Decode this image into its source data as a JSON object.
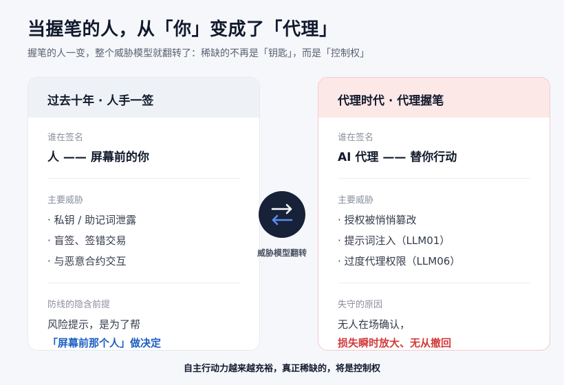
{
  "title": "当握笔的人，从「你」变成了「代理」",
  "subtitle": "握笔的人一变，整个威胁模型就翻转了：稀缺的不再是「钥匙」，而是「控制权」",
  "left_card": {
    "header": "过去十年 · 人手一签",
    "signer_label": "谁在签名",
    "signer_value": "人 —— 屏幕前的你",
    "threats_label": "主要威胁",
    "threats": [
      "· 私钥 / 助记词泄露",
      "· 盲签、签错交易",
      "· 与恶意合约交互"
    ],
    "premise_label": "防线的隐含前提",
    "premise_line1": "风险提示，是为了帮",
    "premise_line2": "「屏幕前那个人」做决定"
  },
  "right_card": {
    "header": "代理时代 · 代理握笔",
    "signer_label": "谁在签名",
    "signer_value": "AI 代理 —— 替你行动",
    "threats_label": "主要威胁",
    "threats": [
      "· 授权被悄悄篡改",
      "· 提示词注入（LLM01）",
      "· 过度代理权限（LLM06）"
    ],
    "failure_label": "失守的原因",
    "failure_line1": "无人在场确认，",
    "failure_line2": "损失瞬时放大、无从撤回"
  },
  "swap": {
    "icon": "swap-arrows-icon",
    "label": "威胁模型翻转"
  },
  "footer": "自主行动力越来越充裕，真正稀缺的，将是控制权",
  "colors": {
    "accent_blue": "#1e5fc2",
    "accent_red": "#d33a3a",
    "dark_circle": "#172238",
    "arrow_white": "#ffffff",
    "arrow_blue": "#5b8def"
  }
}
